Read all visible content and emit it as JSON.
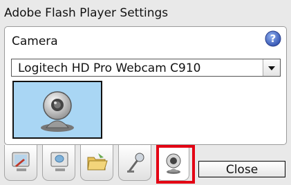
{
  "window": {
    "title": "Adobe Flash Player Settings"
  },
  "camera_section": {
    "label": "Camera",
    "help_icon": "help-icon",
    "selected_device": "Logitech HD Pro Webcam C910",
    "preview_icon": "webcam-icon"
  },
  "tabs": [
    {
      "name": "privacy",
      "icon": "monitor-privacy-icon",
      "active": false
    },
    {
      "name": "local-storage",
      "icon": "storage-monitor-icon",
      "active": false
    },
    {
      "name": "folder",
      "icon": "folder-icon",
      "active": false
    },
    {
      "name": "microphone",
      "icon": "microphone-icon",
      "active": false
    },
    {
      "name": "camera",
      "icon": "webcam-icon",
      "active": true
    }
  ],
  "buttons": {
    "close_label": "Close"
  },
  "colors": {
    "highlight": "#e30013",
    "preview_bg": "#a9d6f4",
    "help_icon": "#3f63c2"
  }
}
